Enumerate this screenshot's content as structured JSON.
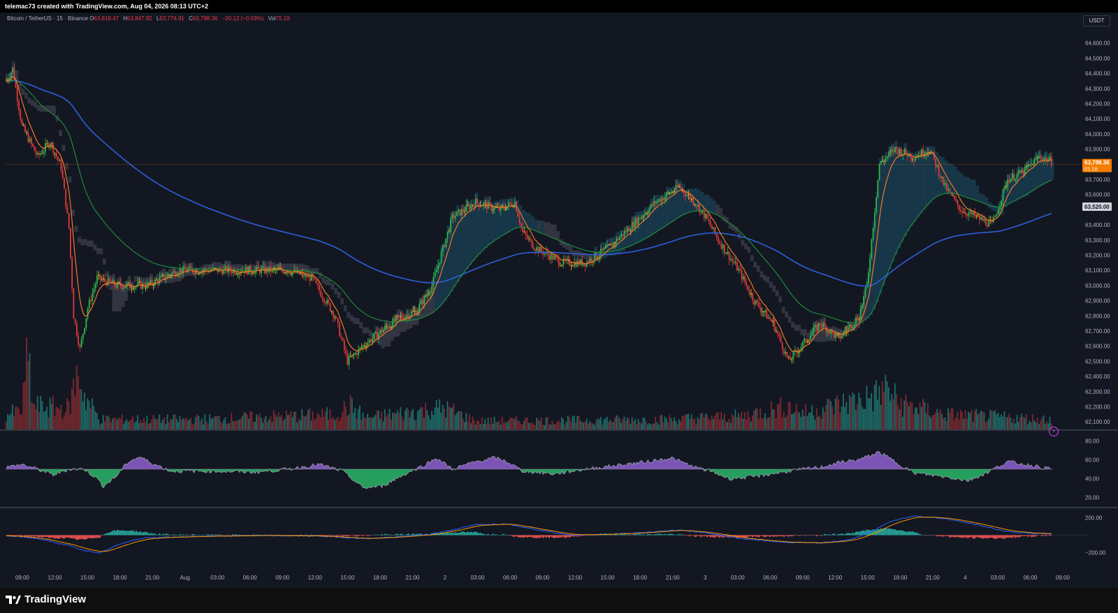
{
  "header": {
    "credit": "telemac73 created with TradingView.com, Aug 04, 2026 08:13 UTC+2"
  },
  "legend": {
    "symbol": "Bitcoin / TetherUS · 15 · Binance",
    "o_label": "O",
    "o_value": "63,818.47",
    "h_label": "H",
    "h_value": "63,847.82",
    "l_label": "L",
    "l_value": "63,774.91",
    "c_label": "C",
    "c_value": "63,798.36",
    "change": "−20.12 (−0.03%)",
    "vol_label": "Vol",
    "vol_value": "75.19"
  },
  "currency_button": "USDT",
  "price_axis": {
    "ticks": [
      "64,600.00",
      "64,500.00",
      "64,400.00",
      "64,300.00",
      "64,200.00",
      "64,100.00",
      "64,000.00",
      "63,900.00",
      "63,700.00",
      "63,600.00",
      "63,400.00",
      "63,300.00",
      "63,200.00",
      "63,100.00",
      "63,000.00",
      "62,900.00",
      "62,800.00",
      "62,700.00",
      "62,600.00",
      "62,500.00",
      "62,400.00",
      "62,300.00",
      "62,200.00",
      "62,100.00"
    ],
    "tick_values": [
      64600,
      64500,
      64400,
      64300,
      64200,
      64100,
      64000,
      63900,
      63700,
      63600,
      63400,
      63300,
      63200,
      63100,
      63000,
      62900,
      62800,
      62700,
      62600,
      62500,
      62400,
      62300,
      62200,
      62100
    ],
    "last_price_label": "63,798.36",
    "countdown": "01:18",
    "highlight_label": "63,520.00",
    "last_price_color": "#f57c00"
  },
  "rsi_axis": {
    "ticks": [
      "80.00",
      "60.00",
      "40.00",
      "20.00"
    ]
  },
  "macd_axis": {
    "ticks": [
      "200.00",
      "−200.00"
    ]
  },
  "time_axis": {
    "labels": [
      "09:00",
      "12:00",
      "15:00",
      "18:00",
      "21:00",
      "Aug",
      "03:00",
      "06:00",
      "09:00",
      "12:00",
      "15:00",
      "18:00",
      "21:00",
      "2",
      "03:00",
      "06:00",
      "09:00",
      "12:00",
      "15:00",
      "18:00",
      "21:00",
      "3",
      "03:00",
      "06:00",
      "09:00",
      "12:00",
      "15:00",
      "18:00",
      "21:00",
      "4",
      "03:00",
      "06:00",
      "09:00"
    ]
  },
  "branding": {
    "name": "TradingView"
  },
  "colors": {
    "up": "#2fb84a",
    "down": "#e23a3a",
    "doji": "#f0c035",
    "ema_fast": "#f07a26",
    "ema_mid": "#1f8a3a",
    "ema_slow": "#2e5fd8",
    "cloud_grey": "#4a4d5a",
    "cloud_teal": "#1c4f66",
    "rsi_up": "#a06ae8",
    "rsi_down": "#2ecc71",
    "macd_line": "#2962ff",
    "signal_line": "#ff9800"
  },
  "chart_data": {
    "type": "candlestick",
    "price_ylim": [
      62050,
      64700
    ],
    "rsi_ylim": [
      10,
      90
    ],
    "macd_ylim": [
      -300,
      300
    ],
    "close_keypoints": [
      [
        0,
        64350
      ],
      [
        4,
        64430
      ],
      [
        10,
        64050
      ],
      [
        20,
        63850
      ],
      [
        28,
        63950
      ],
      [
        35,
        63780
      ],
      [
        40,
        63380
      ],
      [
        43,
        62800
      ],
      [
        47,
        62580
      ],
      [
        52,
        62850
      ],
      [
        58,
        63050
      ],
      [
        70,
        63000
      ],
      [
        90,
        63000
      ],
      [
        110,
        63100
      ],
      [
        140,
        63100
      ],
      [
        160,
        63100
      ],
      [
        180,
        63100
      ],
      [
        195,
        63050
      ],
      [
        210,
        62800
      ],
      [
        218,
        62500
      ],
      [
        230,
        62620
      ],
      [
        250,
        62780
      ],
      [
        262,
        62830
      ],
      [
        272,
        63000
      ],
      [
        285,
        63450
      ],
      [
        300,
        63550
      ],
      [
        315,
        63500
      ],
      [
        325,
        63550
      ],
      [
        330,
        63350
      ],
      [
        338,
        63250
      ],
      [
        355,
        63150
      ],
      [
        370,
        63150
      ],
      [
        385,
        63250
      ],
      [
        400,
        63400
      ],
      [
        415,
        63550
      ],
      [
        430,
        63650
      ],
      [
        440,
        63550
      ],
      [
        447,
        63450
      ],
      [
        455,
        63300
      ],
      [
        468,
        63100
      ],
      [
        478,
        62900
      ],
      [
        490,
        62750
      ],
      [
        500,
        62500
      ],
      [
        508,
        62600
      ],
      [
        520,
        62750
      ],
      [
        532,
        62650
      ],
      [
        545,
        62800
      ],
      [
        550,
        63000
      ],
      [
        558,
        63800
      ],
      [
        568,
        63900
      ],
      [
        580,
        63850
      ],
      [
        590,
        63900
      ],
      [
        600,
        63650
      ],
      [
        610,
        63500
      ],
      [
        620,
        63450
      ],
      [
        630,
        63400
      ],
      [
        640,
        63700
      ],
      [
        650,
        63750
      ],
      [
        660,
        63850
      ],
      [
        668,
        63820
      ]
    ],
    "volume_keypoints": [
      [
        0,
        18
      ],
      [
        10,
        22
      ],
      [
        14,
        90
      ],
      [
        17,
        28
      ],
      [
        40,
        25
      ],
      [
        46,
        70
      ],
      [
        50,
        40
      ],
      [
        60,
        12
      ],
      [
        120,
        12
      ],
      [
        210,
        18
      ],
      [
        220,
        28
      ],
      [
        230,
        14
      ],
      [
        280,
        26
      ],
      [
        300,
        10
      ],
      [
        420,
        12
      ],
      [
        470,
        16
      ],
      [
        500,
        28
      ],
      [
        510,
        20
      ],
      [
        555,
        40
      ],
      [
        563,
        50
      ],
      [
        570,
        32
      ],
      [
        600,
        18
      ],
      [
        668,
        12
      ]
    ],
    "rsi_keypoints": [
      [
        0,
        52
      ],
      [
        10,
        55
      ],
      [
        20,
        50
      ],
      [
        30,
        44
      ],
      [
        40,
        50
      ],
      [
        50,
        50
      ],
      [
        58,
        40
      ],
      [
        62,
        32
      ],
      [
        70,
        42
      ],
      [
        78,
        58
      ],
      [
        85,
        63
      ],
      [
        95,
        55
      ],
      [
        105,
        48
      ],
      [
        130,
        48
      ],
      [
        160,
        47
      ],
      [
        180,
        50
      ],
      [
        200,
        55
      ],
      [
        215,
        48
      ],
      [
        228,
        30
      ],
      [
        240,
        32
      ],
      [
        255,
        45
      ],
      [
        268,
        55
      ],
      [
        275,
        62
      ],
      [
        285,
        50
      ],
      [
        300,
        58
      ],
      [
        312,
        62
      ],
      [
        320,
        58
      ],
      [
        330,
        48
      ],
      [
        350,
        45
      ],
      [
        370,
        50
      ],
      [
        395,
        55
      ],
      [
        410,
        58
      ],
      [
        425,
        62
      ],
      [
        440,
        52
      ],
      [
        450,
        48
      ],
      [
        462,
        40
      ],
      [
        478,
        42
      ],
      [
        500,
        48
      ],
      [
        520,
        52
      ],
      [
        535,
        58
      ],
      [
        545,
        60
      ],
      [
        558,
        68
      ],
      [
        568,
        58
      ],
      [
        580,
        46
      ],
      [
        600,
        42
      ],
      [
        615,
        38
      ],
      [
        625,
        45
      ],
      [
        640,
        58
      ],
      [
        655,
        54
      ],
      [
        668,
        50
      ]
    ],
    "macd_keypoints": [
      [
        0,
        -10
      ],
      [
        10,
        -20
      ],
      [
        20,
        -40
      ],
      [
        30,
        -80
      ],
      [
        40,
        -120
      ],
      [
        50,
        -180
      ],
      [
        60,
        -200
      ],
      [
        70,
        -120
      ],
      [
        80,
        -60
      ],
      [
        90,
        -30
      ],
      [
        120,
        -15
      ],
      [
        160,
        -5
      ],
      [
        200,
        -10
      ],
      [
        230,
        -40
      ],
      [
        250,
        -20
      ],
      [
        270,
        10
      ],
      [
        285,
        60
      ],
      [
        300,
        120
      ],
      [
        320,
        130
      ],
      [
        340,
        60
      ],
      [
        360,
        0
      ],
      [
        400,
        20
      ],
      [
        430,
        60
      ],
      [
        450,
        20
      ],
      [
        470,
        -40
      ],
      [
        495,
        -80
      ],
      [
        520,
        -90
      ],
      [
        540,
        -50
      ],
      [
        555,
        60
      ],
      [
        565,
        160
      ],
      [
        580,
        220
      ],
      [
        600,
        190
      ],
      [
        620,
        120
      ],
      [
        640,
        40
      ],
      [
        655,
        20
      ],
      [
        668,
        15
      ]
    ],
    "candle_count": 669
  }
}
